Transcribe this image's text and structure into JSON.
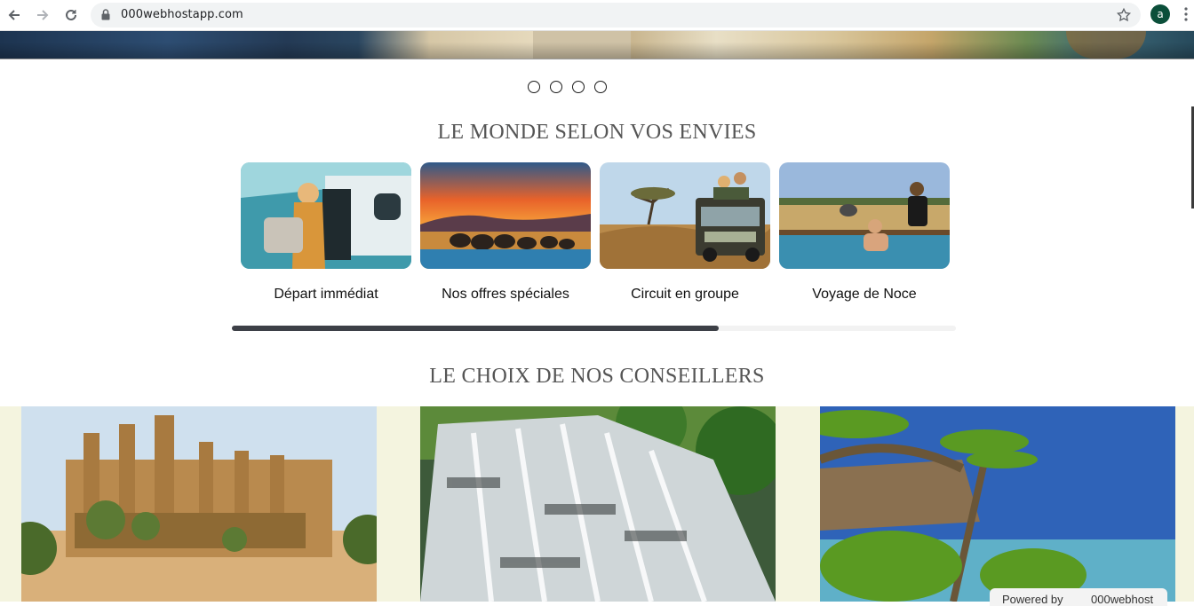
{
  "browser": {
    "url": "000webhostapp.com",
    "avatar_letter": "a"
  },
  "icons": {
    "back": "arrow-left-icon",
    "forward": "arrow-right-icon",
    "reload": "reload-icon",
    "lock": "lock-icon",
    "star": "star-icon",
    "menu": "kebab-menu-icon"
  },
  "carousel": {
    "slide_count": 4
  },
  "sections": {
    "world_title": "LE MONDE SELON VOS ENVIES",
    "advisors_title": "LE CHOIX DE NOS CONSEILLERS"
  },
  "categories": [
    {
      "label": "Départ immédiat"
    },
    {
      "label": "Nos offres spéciales"
    },
    {
      "label": "Circuit en groupe"
    },
    {
      "label": "Voyage de Noce"
    }
  ],
  "footer_badge": {
    "text": "Powered by",
    "brand": "000webhost"
  },
  "colors": {
    "heading": "#555555",
    "band": "#f4f4df",
    "scroll_thumb": "#3d4047"
  }
}
